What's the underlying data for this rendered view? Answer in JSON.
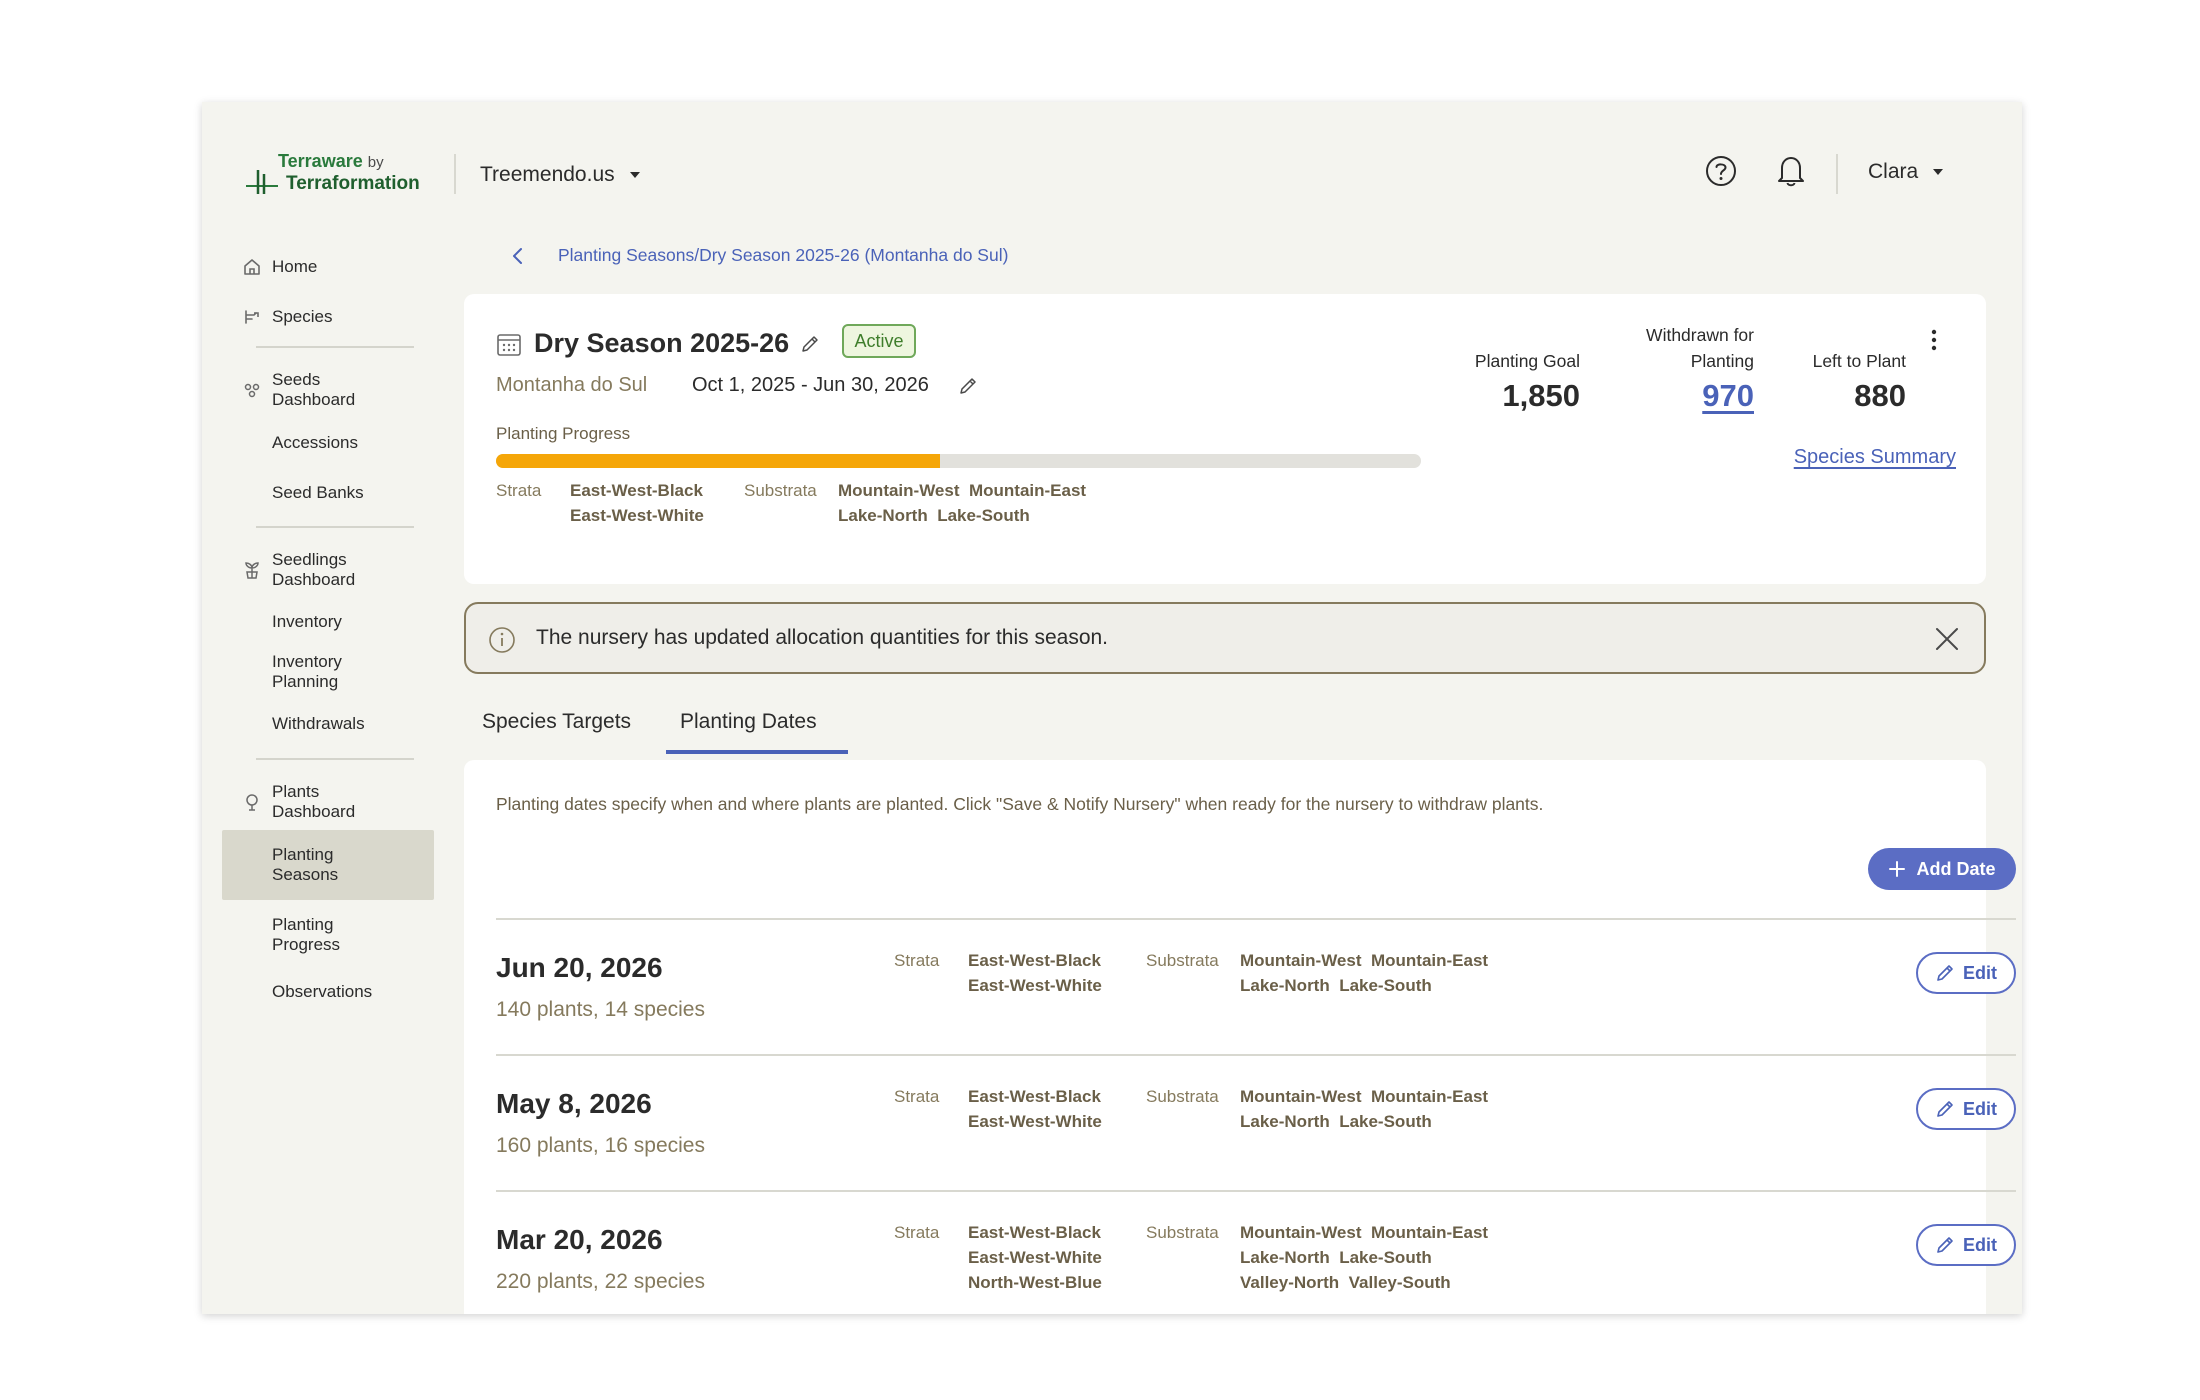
{
  "brand": {
    "name": "Terraware",
    "by": "by",
    "company": "Terraformation"
  },
  "header": {
    "org_name": "Treemendo.us",
    "user_name": "Clara"
  },
  "sidebar": {
    "items": [
      {
        "label": "Home",
        "icon": "home-icon"
      },
      {
        "label": "Species",
        "icon": "species-icon"
      },
      {
        "label": "Seeds Dashboard",
        "icon": "seeds-icon"
      },
      {
        "label": "Accessions"
      },
      {
        "label": "Seed Banks"
      },
      {
        "label": "Seedlings Dashboard",
        "icon": "seedlings-icon"
      },
      {
        "label": "Inventory"
      },
      {
        "label": "Inventory Planning"
      },
      {
        "label": "Withdrawals"
      },
      {
        "label": "Plants Dashboard",
        "icon": "plants-icon"
      },
      {
        "label": "Planting Seasons",
        "active": true
      },
      {
        "label": "Planting Progress"
      },
      {
        "label": "Observations"
      }
    ]
  },
  "breadcrumb": "Planting Seasons/Dry Season 2025-26 (Montanha do Sul)",
  "season": {
    "title": "Dry Season 2025-26",
    "status": "Active",
    "site": "Montanha do Sul",
    "date_range": "Oct 1, 2025 - Jun 30, 2026",
    "progress_label": "Planting Progress",
    "progress_fraction": 0.48,
    "strata_label": "Strata",
    "strata": [
      "East-West-Black",
      "East-West-White"
    ],
    "substrata_label": "Substrata",
    "substrata": [
      "Mountain-West",
      "Mountain-East",
      "Lake-North",
      "Lake-South"
    ],
    "stats": [
      {
        "label": "Planting Goal",
        "value": "1,850"
      },
      {
        "label": "Withdrawn for Planting",
        "value": "970"
      },
      {
        "label": "Left to Plant",
        "value": "880"
      }
    ],
    "species_summary": "Species Summary"
  },
  "banner": {
    "text": "The nursery has updated allocation quantities for this season."
  },
  "tabs": [
    {
      "label": "Species Targets",
      "active": false
    },
    {
      "label": "Planting Dates",
      "active": true
    }
  ],
  "planting_dates": {
    "help": "Planting dates specify when and where plants are planted. Click \"Save & Notify Nursery\" when ready for the nursery to withdraw plants.",
    "add_label": "Add Date",
    "edit_label": "Edit",
    "strata_label": "Strata",
    "substrata_label": "Substrata",
    "rows": [
      {
        "date": "Jun 20, 2026",
        "summary": "140 plants, 14 species",
        "strata": [
          "East-West-Black",
          "East-West-White"
        ],
        "substrata": [
          "Mountain-West",
          "Mountain-East",
          "Lake-North",
          "Lake-South"
        ]
      },
      {
        "date": "May 8, 2026",
        "summary": "160 plants, 16 species",
        "strata": [
          "East-West-Black",
          "East-West-White"
        ],
        "substrata": [
          "Mountain-West",
          "Mountain-East",
          "Lake-North",
          "Lake-South"
        ]
      },
      {
        "date": "Mar 20, 2026",
        "summary": "220 plants, 22 species",
        "strata": [
          "East-West-Black",
          "East-West-White",
          "North-West-Blue"
        ],
        "substrata": [
          "Mountain-West",
          "Mountain-East",
          "Lake-North",
          "Lake-South",
          "Valley-North",
          "Valley-South"
        ]
      }
    ]
  },
  "colors": {
    "accent": "#4a62b8",
    "button": "#5b6dc4",
    "progress": "#f5a608",
    "active_badge": "#3e7d2b",
    "muted_text": "#857a5d"
  }
}
